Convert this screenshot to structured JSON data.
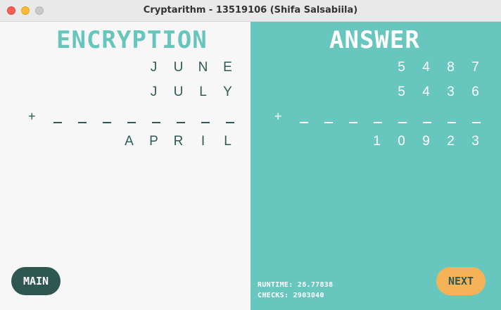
{
  "window": {
    "title": "Cryptarithm - 13519106 (Shifa Salsabiila)"
  },
  "encryption": {
    "heading": "ENCRYPTION",
    "rows": [
      [
        "",
        "",
        "",
        "J",
        "U",
        "N",
        "E"
      ],
      [
        "",
        "",
        "",
        "J",
        "U",
        "L",
        "Y"
      ]
    ],
    "plus": "+",
    "result": [
      "",
      "",
      "A",
      "P",
      "R",
      "I",
      "L"
    ]
  },
  "answer": {
    "heading": "ANSWER",
    "rows": [
      [
        "",
        "",
        "",
        "5",
        "4",
        "8",
        "7"
      ],
      [
        "",
        "",
        "",
        "5",
        "4",
        "3",
        "6"
      ]
    ],
    "plus": "+",
    "result": [
      "",
      "",
      "1",
      "0",
      "9",
      "2",
      "3"
    ]
  },
  "stats": {
    "runtime": "RUNTIME: 26.77838",
    "checks": "CHECKS: 2903040"
  },
  "buttons": {
    "main": "MAIN",
    "next": "NEXT"
  }
}
